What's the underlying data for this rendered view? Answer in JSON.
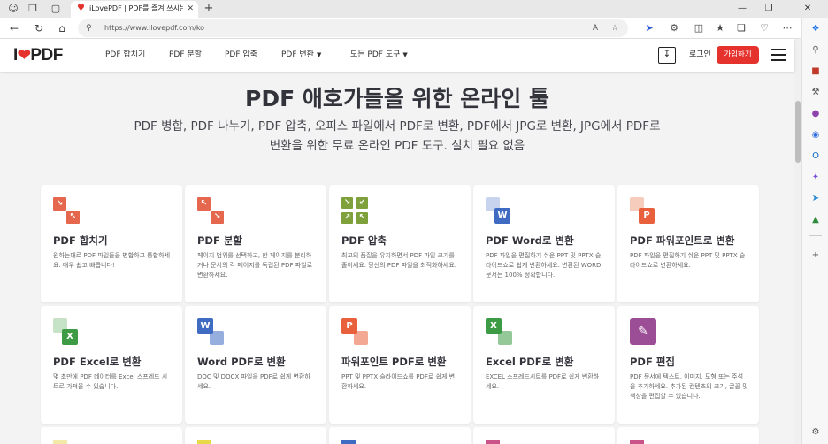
{
  "browser": {
    "tab_title": "iLovePDF | PDF를 즐겨 쓰시는 분",
    "url": "https://www.ilovepdf.com/ko"
  },
  "site": {
    "logo_left": "I",
    "logo_right": "PDF",
    "nav": [
      {
        "label": "PDF 합치기"
      },
      {
        "label": "PDF 분할"
      },
      {
        "label": "PDF 압축"
      },
      {
        "label": "PDF 변환"
      },
      {
        "label": "모든 PDF 도구"
      }
    ],
    "login": "로그인",
    "signup": "가입하기"
  },
  "hero": {
    "title": "PDF 애호가들을 위한 온라인 툴",
    "subtitle": "PDF 병합, PDF 나누기, PDF 압축, 오피스 파일에서 PDF로 변환, PDF에서 JPG로 변환, JPG에서 PDF로 변환을 위한 무료 온라인 PDF 도구. 설치 필요 없음"
  },
  "tools": [
    {
      "title": "PDF 합치기",
      "desc": "원하는대로 PDF 파일들을 병합하고 통합하세요. 매우 쉽고 빠릅니다!"
    },
    {
      "title": "PDF 분할",
      "desc": "페이지 범위를 선택하고, 한 페이지를 분리하거나 문서의 각 페이지를 독립된 PDF 파일로 변환하세요."
    },
    {
      "title": "PDF 압축",
      "desc": "최고의 품질을 유지하면서 PDF 파일 크기를 줄이세요. 당신의 PDF 파일을 최적화하세요."
    },
    {
      "title": "PDF Word로 변환",
      "desc": "PDF 파일을 편집하기 쉬운 PPT 및 PPTX 슬라이드쇼로 쉽게 변환하세요. 변환된 WORD 문서는 100% 정확합니다."
    },
    {
      "title": "PDF 파워포인트로 변환",
      "desc": "PDF 파일을 편집하기 쉬운 PPT 및 PPTX 슬라이드쇼로 변환하세요."
    },
    {
      "title": "PDF Excel로 변환",
      "desc": "몇 초만에 PDF 데이터를 Excel 스프레드 시트로 가져올 수 있습니다."
    },
    {
      "title": "Word PDF로 변환",
      "desc": "DOC 및 DOCX 파일을 PDF로 쉽게 변환하세요."
    },
    {
      "title": "파워포인트 PDF로 변환",
      "desc": "PPT 및 PPTX 슬라이드쇼를 PDF로 쉽게 변환하세요."
    },
    {
      "title": "Excel PDF로 변환",
      "desc": "EXCEL 스프레드시트를 PDF로 쉽게 변환하세요."
    },
    {
      "title": "PDF 편집",
      "desc": "PDF 문서에 텍스트, 이미지, 도형 또는 주석을 추가하세요. 추가된 컨텐츠의 크기, 글꼴 및 색상을 편집할 수 있습니다."
    }
  ],
  "icon_letters": {
    "word": "W",
    "ppt": "P",
    "excel": "X"
  },
  "colors": {
    "brand_red": "#e5322d",
    "merge": "#e5674d",
    "compress": "#7ea13b",
    "word": "#3f6bc3",
    "ppt": "#e9613c",
    "excel": "#3d9a45",
    "edit": "#9b4d96"
  }
}
